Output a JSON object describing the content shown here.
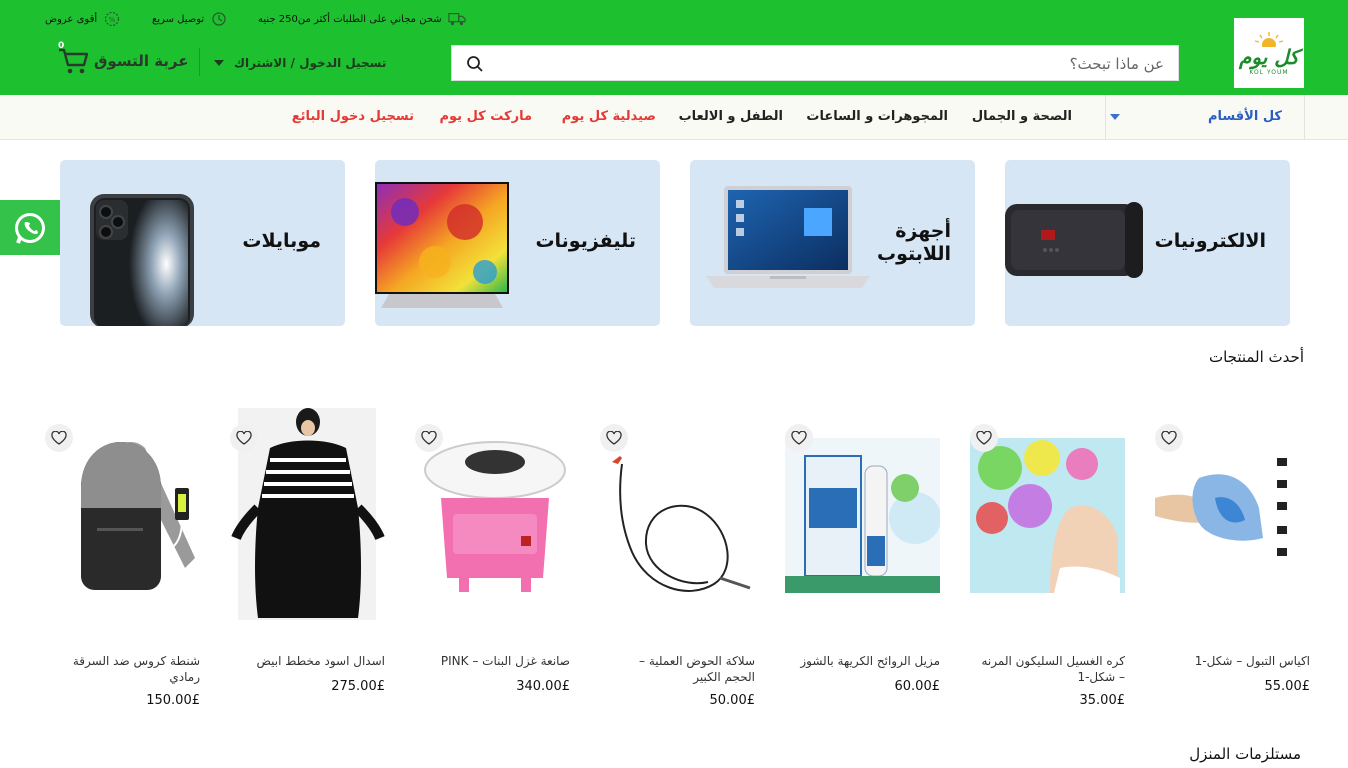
{
  "header": {
    "perks": [
      {
        "label": "شحن مجاني على الطلبات أكثر من250 جنيه",
        "icon": "delivery-truck-icon"
      },
      {
        "label": "توصيل سريع",
        "icon": "fast-delivery-icon"
      },
      {
        "label": "أقوى عروض",
        "icon": "offer-badge-icon"
      }
    ],
    "logo_text": "كل يوم",
    "logo_sub": "KOL YOUM",
    "search_placeholder": "عن ماذا تبحث؟",
    "account_label": "تسجيل الدخول / الاشتراك",
    "cart_label": "عربة التسوق",
    "cart_count": "0"
  },
  "nav": {
    "all_categories": "كل الأقسام",
    "items": [
      {
        "label": "الصحة و الجمال",
        "color": "#222222"
      },
      {
        "label": "المجوهرات و الساعات",
        "color": "#222222"
      },
      {
        "label": "الطفل و الالعاب",
        "color": "#222222"
      },
      {
        "label": "صيدلية كل يوم",
        "color": "#e53935"
      },
      {
        "label": "ماركت كل يوم",
        "color": "#e53935"
      },
      {
        "label": "تسجيل دخول البائع",
        "color": "#e53935"
      }
    ]
  },
  "categories": [
    {
      "title": "الالكترونيات"
    },
    {
      "title": "أجهزة\nاللابتوب"
    },
    {
      "title": "تليفزيونات"
    },
    {
      "title": "موبايلات"
    }
  ],
  "sections": {
    "latest": "أحدث المنتجات",
    "home": "مستلزمات المنزل"
  },
  "products": [
    {
      "name": "اكياس التبول – شكل-1",
      "price": "55.00£"
    },
    {
      "name": "كره الغسيل السليكون المرنه – شكل-1",
      "price": "35.00£"
    },
    {
      "name": "مزيل الروائح الكريهة بالشوز",
      "price": "60.00£"
    },
    {
      "name": "سلاكة الحوض العملية – الحجم الكبير",
      "price": "50.00£"
    },
    {
      "name": "صانعة غزل البنات – PINK",
      "price": "340.00£"
    },
    {
      "name": "اسدال اسود مخطط ابيض",
      "price": "275.00£"
    },
    {
      "name": "شنطة كروس ضد السرقة رمادي",
      "price": "150.00£"
    }
  ],
  "colors": {
    "brand_green": "#1dc130",
    "nav_accent_blue": "#2b5ec4",
    "nav_highlight_red": "#e53935",
    "category_bg": "#d6e6f5"
  }
}
